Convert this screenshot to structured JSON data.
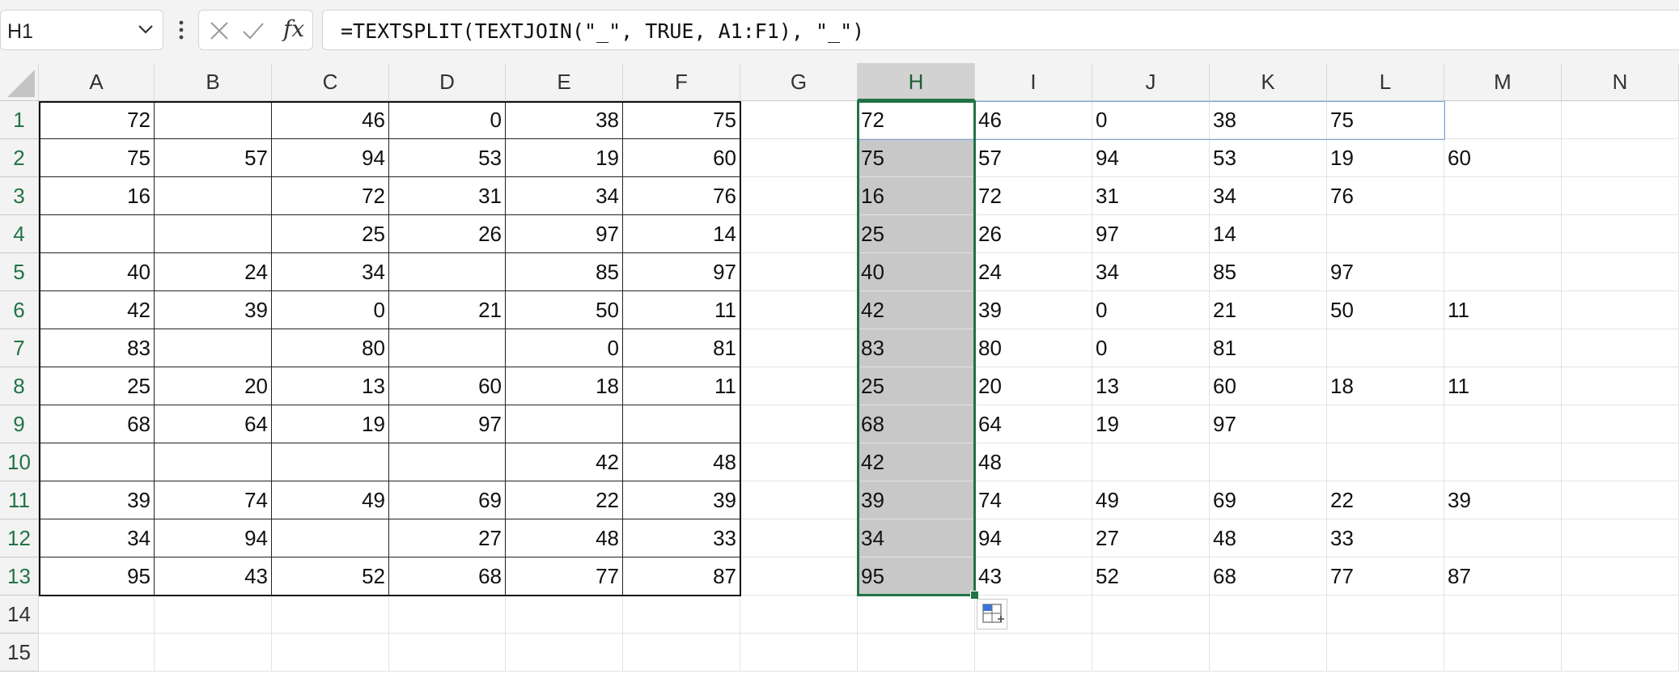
{
  "namebox": {
    "value": "H1"
  },
  "formula": {
    "text": "=TEXTSPLIT(TEXTJOIN(\"_\", TRUE, A1:F1), \"_\")"
  },
  "icons": {
    "dropdown": "chevron-down-icon",
    "more": "more-vertical-icon",
    "cancel": "x-icon",
    "enter": "check-icon",
    "function": "fx-icon",
    "quick_analysis": "quick-analysis-icon"
  },
  "fx_label": "fx",
  "colors": {
    "selection": "#217346",
    "selected_fill": "#c8c8c8",
    "spill_border": "#7ba6d8"
  },
  "columns": [
    "A",
    "B",
    "C",
    "D",
    "E",
    "F",
    "G",
    "H",
    "I",
    "J",
    "K",
    "L",
    "M",
    "N"
  ],
  "rows": [
    "1",
    "2",
    "3",
    "4",
    "5",
    "6",
    "7",
    "8",
    "9",
    "10",
    "11",
    "12",
    "13",
    "14",
    "15"
  ],
  "selected_column": "H",
  "source_table": [
    [
      "72",
      "",
      "46",
      "0",
      "38",
      "75"
    ],
    [
      "75",
      "57",
      "94",
      "53",
      "19",
      "60"
    ],
    [
      "16",
      "",
      "72",
      "31",
      "34",
      "76"
    ],
    [
      "",
      "",
      "25",
      "26",
      "97",
      "14"
    ],
    [
      "40",
      "24",
      "34",
      "",
      "85",
      "97"
    ],
    [
      "42",
      "39",
      "0",
      "21",
      "50",
      "11"
    ],
    [
      "83",
      "",
      "80",
      "",
      "0",
      "81"
    ],
    [
      "25",
      "20",
      "13",
      "60",
      "18",
      "11"
    ],
    [
      "68",
      "64",
      "19",
      "97",
      "",
      ""
    ],
    [
      "",
      "",
      "",
      "",
      "42",
      "48"
    ],
    [
      "39",
      "74",
      "49",
      "69",
      "22",
      "39"
    ],
    [
      "34",
      "94",
      "",
      "27",
      "48",
      "33"
    ],
    [
      "95",
      "43",
      "52",
      "68",
      "77",
      "87"
    ]
  ],
  "result_table": [
    [
      "72",
      "46",
      "0",
      "38",
      "75",
      ""
    ],
    [
      "75",
      "57",
      "94",
      "53",
      "19",
      "60"
    ],
    [
      "16",
      "72",
      "31",
      "34",
      "76",
      ""
    ],
    [
      "25",
      "26",
      "97",
      "14",
      "",
      ""
    ],
    [
      "40",
      "24",
      "34",
      "85",
      "97",
      ""
    ],
    [
      "42",
      "39",
      "0",
      "21",
      "50",
      "11"
    ],
    [
      "83",
      "80",
      "0",
      "81",
      "",
      ""
    ],
    [
      "25",
      "20",
      "13",
      "60",
      "18",
      "11"
    ],
    [
      "68",
      "64",
      "19",
      "97",
      "",
      ""
    ],
    [
      "42",
      "48",
      "",
      "",
      "",
      ""
    ],
    [
      "39",
      "74",
      "49",
      "69",
      "22",
      "39"
    ],
    [
      "34",
      "94",
      "27",
      "48",
      "33",
      ""
    ],
    [
      "95",
      "43",
      "52",
      "68",
      "77",
      "87"
    ]
  ]
}
